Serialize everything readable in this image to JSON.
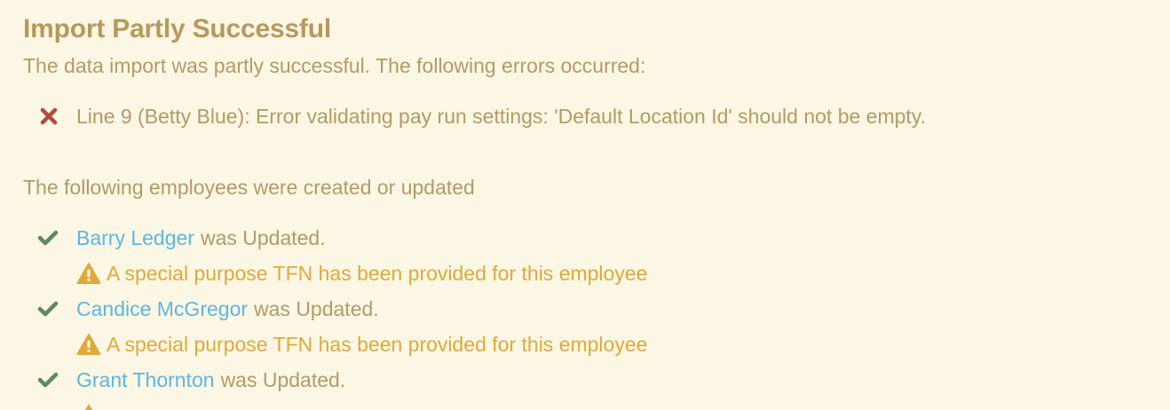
{
  "header": {
    "title": "Import Partly Successful",
    "intro": "The data import was partly successful. The following errors occurred:"
  },
  "errors": [
    {
      "icon": "x-icon",
      "text": "Line 9 (Betty Blue): Error validating pay run settings: 'Default Location Id' should not be empty."
    }
  ],
  "employees_section": {
    "heading": "The following employees were created or updated",
    "items": [
      {
        "name": "Barry Ledger",
        "status": "was Updated.",
        "warning": "A special purpose TFN has been provided for this employee"
      },
      {
        "name": "Candice McGregor",
        "status": "was Updated.",
        "warning": "A special purpose TFN has been provided for this employee"
      },
      {
        "name": "Grant Thornton",
        "status": "was Updated."
      }
    ]
  },
  "colors": {
    "background": "#fbf7e4",
    "text": "#b49a66",
    "title": "#b8995c",
    "link": "#5db6e3",
    "success": "#5c8c5c",
    "error": "#b24a3f",
    "warning": "#e0a93a"
  }
}
